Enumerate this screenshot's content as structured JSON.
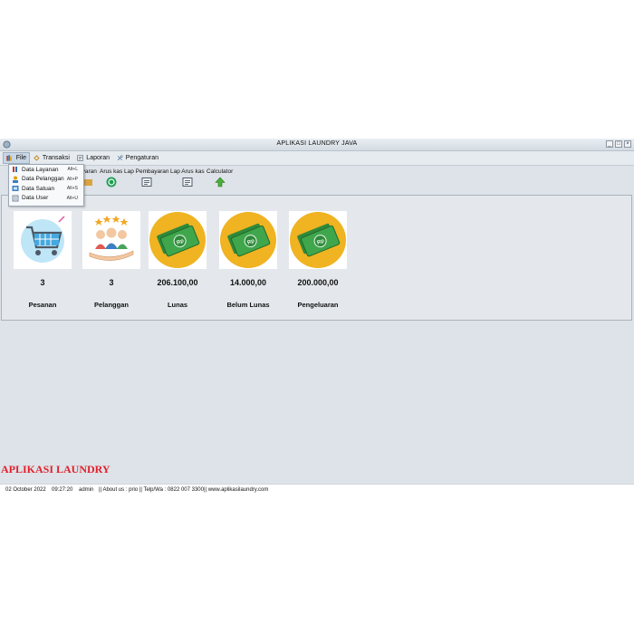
{
  "window": {
    "title": "APLIKASI LAUNDRY JAVA"
  },
  "menubar": {
    "items": [
      {
        "label": "File",
        "icon": "file-books-icon"
      },
      {
        "label": "Transaksi",
        "icon": "transaction-icon"
      },
      {
        "label": "Laporan",
        "icon": "report-icon"
      },
      {
        "label": "Pengaturan",
        "icon": "tools-icon"
      }
    ]
  },
  "file_menu": {
    "items": [
      {
        "label": "Data Layanan",
        "shortcut": "Alt+L",
        "icon": "service-icon"
      },
      {
        "label": "Data Pelanggan",
        "shortcut": "Alt+P",
        "icon": "customer-icon"
      },
      {
        "label": "Data Satuan",
        "shortcut": "Alt+S",
        "icon": "unit-icon"
      },
      {
        "label": "Data User",
        "shortcut": "Alt+U",
        "icon": "user-icon"
      }
    ]
  },
  "toolbar": {
    "items": [
      {
        "label": "ayaran"
      },
      {
        "label": "Arus kas"
      },
      {
        "label": "Lap Pembayaran"
      },
      {
        "label": "Lap Arus kas"
      },
      {
        "label": "Calculator"
      }
    ]
  },
  "dashboard": {
    "cards": [
      {
        "value": "3",
        "label": "Pesanan",
        "icon": "shopping-cart-icon"
      },
      {
        "value": "3",
        "label": "Pelanggan",
        "icon": "customers-rating-icon"
      },
      {
        "value": "206.100,00",
        "label": "Lunas",
        "icon": "money-icon"
      },
      {
        "value": "14.000,00",
        "label": "Belum Lunas",
        "icon": "money-icon"
      },
      {
        "value": "200.000,00",
        "label": "Pengeluaran",
        "icon": "money-icon"
      }
    ]
  },
  "brand": "APLIKASI LAUNDRY",
  "status": {
    "date": "02 October 2022",
    "time": "09:27:20",
    "user": "admin",
    "info": "|| About us : prio  || Telp/Wa : 0822 007 3300|| www.aplikasilaundry.com"
  },
  "colors": {
    "brand": "#e31e2b",
    "money_circle": "#f0b321",
    "money_green": "#2f8a3b"
  }
}
